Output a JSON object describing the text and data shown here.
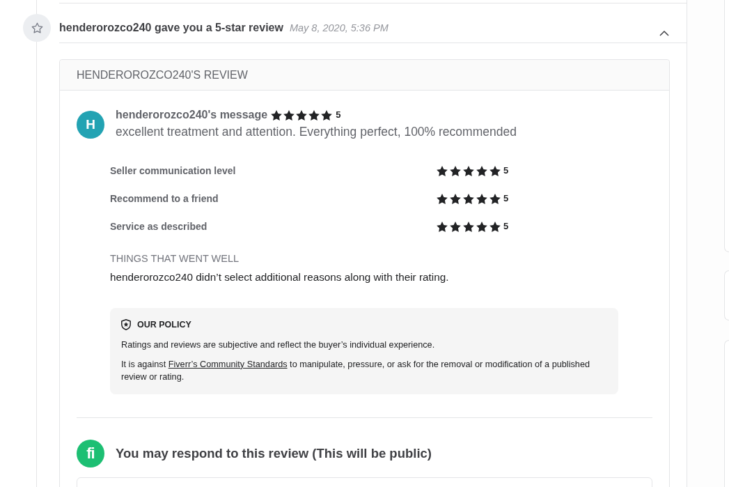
{
  "notification": {
    "title": "henderorozco240 gave you a 5-star review",
    "time": "May 8, 2020, 5:36 PM",
    "expanded": true
  },
  "review": {
    "heading": "HENDEROROZCO240'S REVIEW",
    "message": {
      "initial": "H",
      "title": "henderorozco240's message",
      "stars": 5,
      "rating": "5",
      "comment": "excellent treatment and attention. Everything perfect, 100% recommended"
    },
    "ratings": [
      {
        "label": "Seller communication level",
        "stars": 5,
        "rating": "5"
      },
      {
        "label": "Recommend to a friend",
        "stars": 5,
        "rating": "5"
      },
      {
        "label": "Service as described",
        "stars": 5,
        "rating": "5"
      }
    ],
    "things_went_well": {
      "title": "THINGS THAT WENT WELL",
      "text": "henderorozco240 didn’t select additional reasons along with their rating."
    },
    "policy": {
      "title": "OUR POLICY",
      "paragraphs": [
        {
          "parts": [
            {
              "kind": "text",
              "text": "Ratings and reviews are subjective and reflect the buyer’s individual experience."
            }
          ]
        },
        {
          "parts": [
            {
              "kind": "text",
              "text": "It is against "
            },
            {
              "kind": "link",
              "text": "Fiverr’s Community Standards"
            },
            {
              "kind": "text",
              "text": " to manipulate, pressure, or ask for the removal or modification of a published review or rating."
            }
          ]
        }
      ]
    }
  },
  "respond": {
    "logo": "fi",
    "title": "You may respond to this review (This will be public)"
  }
}
